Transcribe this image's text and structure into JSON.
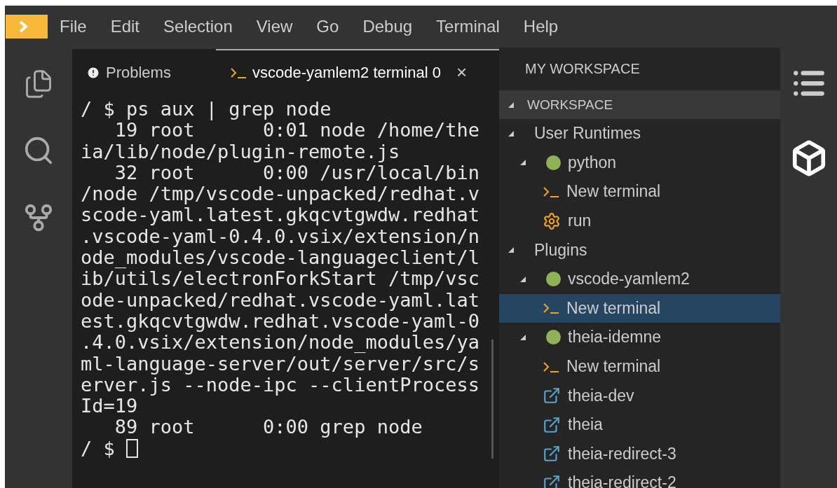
{
  "menu": [
    "File",
    "Edit",
    "Selection",
    "View",
    "Go",
    "Debug",
    "Terminal",
    "Help"
  ],
  "tabs": [
    {
      "label": "Problems",
      "kind": "problems",
      "selected": false,
      "closable": false
    },
    {
      "label": "vscode-yamlem2 terminal 0",
      "kind": "terminal",
      "selected": true,
      "closable": true
    }
  ],
  "close_glyph": "×",
  "terminal": {
    "lines": [
      "/ $ ps aux | grep node",
      "   19 root      0:01 node /home/the",
      "ia/lib/node/plugin-remote.js",
      "   32 root      0:00 /usr/local/bin",
      "/node /tmp/vscode-unpacked/redhat.v",
      "scode-yaml.latest.gkqcvtgwdw.redhat",
      ".vscode-yaml-0.4.0.vsix/extension/n",
      "ode_modules/vscode-languageclient/l",
      "ib/utils/electronForkStart /tmp/vsc",
      "ode-unpacked/redhat.vscode-yaml.lat",
      "est.gkqcvtgwdw.redhat.vscode-yaml-0",
      ".4.0.vsix/extension/node_modules/ya",
      "ml-language-server/out/server/src/s",
      "erver.js --node-ipc --clientProcess",
      "Id=19",
      "   89 root      0:00 grep node"
    ],
    "prompt": "/ $ "
  },
  "workspace": {
    "title": "MY WORKSPACE",
    "section": {
      "label": "WORKSPACE",
      "expanded": true
    },
    "items": [
      {
        "label": "User Runtimes",
        "expanded": true,
        "selected": false,
        "children": [
          {
            "label": "python",
            "kind": "runtime",
            "expanded": true,
            "selected": false,
            "children": [
              {
                "label": "New terminal",
                "kind": "terminal",
                "selected": false
              },
              {
                "label": "run",
                "kind": "task",
                "selected": false
              }
            ]
          }
        ]
      },
      {
        "label": "Plugins",
        "expanded": true,
        "selected": false,
        "children": [
          {
            "label": "vscode-yamlem2",
            "kind": "runtime",
            "expanded": true,
            "selected": false,
            "children": [
              {
                "label": "New terminal",
                "kind": "terminal",
                "selected": true
              }
            ]
          },
          {
            "label": "theia-idemne",
            "kind": "runtime",
            "expanded": true,
            "selected": false,
            "children": [
              {
                "label": "New terminal",
                "kind": "terminal",
                "selected": false
              },
              {
                "label": "theia-dev",
                "kind": "link",
                "selected": false
              },
              {
                "label": "theia",
                "kind": "link",
                "selected": false
              },
              {
                "label": "theia-redirect-3",
                "kind": "link",
                "selected": false
              },
              {
                "label": "theia-redirect-2",
                "kind": "link",
                "selected": false
              }
            ]
          }
        ]
      }
    ]
  }
}
